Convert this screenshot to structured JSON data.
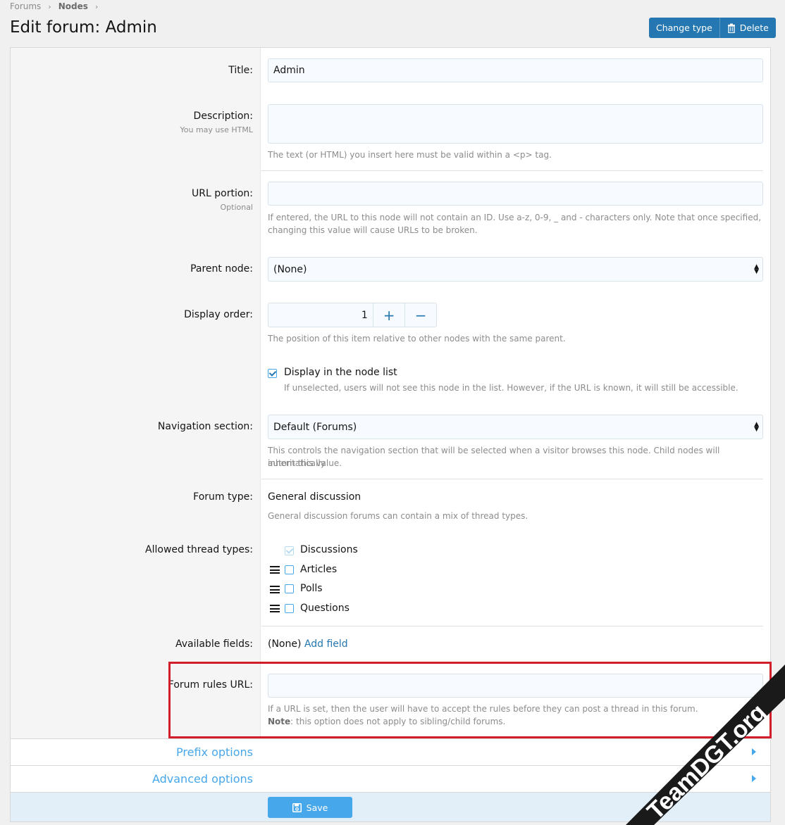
{
  "breadcrumb": {
    "items": [
      "Forums",
      "Nodes"
    ]
  },
  "page": {
    "title": "Edit forum: Admin"
  },
  "actions": {
    "change_type": "Change type",
    "delete": "Delete"
  },
  "form": {
    "title": {
      "label": "Title:",
      "value": "Admin"
    },
    "description": {
      "label": "Description:",
      "hint": "You may use HTML",
      "value": "",
      "explain": "The text (or HTML) you insert here must be valid within a <p> tag."
    },
    "url_portion": {
      "label": "URL portion:",
      "hint": "Optional",
      "value": "",
      "explain_1": "If entered, the URL to this node will not contain an ID. Use a-z, 0-9, _ and - characters only. Note that once specified,",
      "explain_2": "changing this value will cause URLs to be broken."
    },
    "parent_node": {
      "label": "Parent node:",
      "value": "(None)"
    },
    "display_order": {
      "label": "Display order:",
      "value": "1",
      "plus": "+",
      "minus": "−",
      "explain": "The position of this item relative to other nodes with the same parent."
    },
    "display_in_list": {
      "label": "Display in the node list",
      "checked": true,
      "explain": "If unselected, users will not see this node in the list. However, if the URL is known, it will still be accessible."
    },
    "navigation": {
      "label": "Navigation section:",
      "value": "Default (Forums)",
      "explain_1": "This controls the navigation section that will be selected when a visitor browses this node. Child nodes will automatically",
      "explain_2": "inherit this value."
    },
    "forum_type": {
      "label": "Forum type:",
      "value": "General discussion",
      "explain": "General discussion forums can contain a mix of thread types."
    },
    "thread_types": {
      "label": "Allowed thread types:",
      "items": [
        {
          "label": "Discussions",
          "checked": true,
          "disabled": true
        },
        {
          "label": "Articles",
          "checked": false
        },
        {
          "label": "Polls",
          "checked": false
        },
        {
          "label": "Questions",
          "checked": false
        }
      ]
    },
    "available_fields": {
      "label": "Available fields:",
      "value": "(None)",
      "link": "Add field"
    },
    "forum_rules_url": {
      "label": "Forum rules URL:",
      "value": "",
      "explain_1": "If a URL is set, then the user will have to accept the rules before they can post a thread in this forum.",
      "note_label": "Note",
      "note_text": ": this option does not apply to sibling/child forums."
    }
  },
  "sections": {
    "prefix": "Prefix options",
    "advanced": "Advanced options"
  },
  "footer": {
    "save": "Save"
  },
  "watermark": {
    "text": "TeamDGT.org"
  },
  "colors": {
    "accent": "#2577b1",
    "link": "#47a7eb",
    "highlight": "#d21e2a"
  }
}
